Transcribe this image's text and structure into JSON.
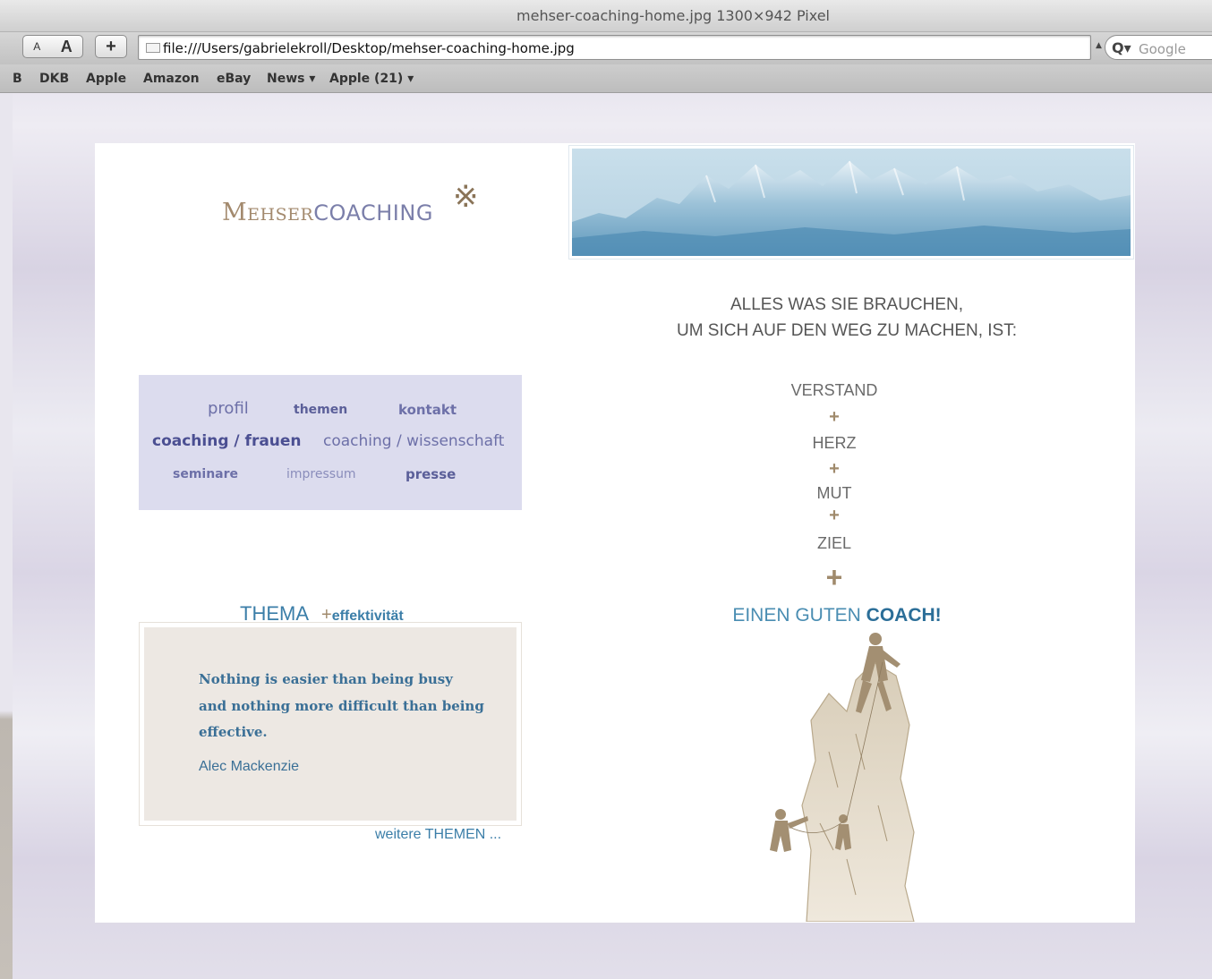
{
  "browser": {
    "window_title": "mehser-coaching-home.jpg 1300×942 Pixel",
    "text_small_label": "A",
    "text_big_label": "A",
    "add_label": "+",
    "address": "file:///Users/gabrielekroll/Desktop/mehser-coaching-home.jpg",
    "search_placeholder": "Google",
    "bookmarks": [
      "B",
      "DKB",
      "Apple",
      "Amazon",
      "eBay",
      "News ▾",
      "Apple (21) ▾"
    ]
  },
  "page": {
    "logo": {
      "part1": "Mehser",
      "part2": "coaching",
      "mark": "※"
    },
    "slogan": [
      "ALLES WAS SIE BRAUCHEN,",
      "UM SICH AUF DEN WEG ZU MACHEN, IST:"
    ],
    "stack": [
      "VERSTAND",
      "HERZ",
      "MUT",
      "ZIEL"
    ],
    "plus": "+",
    "coach_prefix": "EINEN GUTEN ",
    "coach_bold": "COACH!",
    "nav": {
      "profil": "profil",
      "themen": "themen",
      "kontakt": "kontakt",
      "coaching_frauen": "coaching / frauen",
      "coaching_wissenschaft": "coaching / wissenschaft",
      "seminare": "seminare",
      "impressum": "impressum",
      "presse": "presse"
    },
    "thema": {
      "title": "THEMA",
      "plus": "+",
      "subtitle": "effektivität",
      "quote": "Nothing is easier than being busy and nothing more difficult than being effective.",
      "author": "Alec Mackenzie",
      "more_link": "weitere THEMEN ..."
    }
  },
  "colors": {
    "accent_blue": "#3b7ea8",
    "accent_brown": "#a08a6c",
    "nav_background": "#dcdcee",
    "quote_background": "#ede8e3"
  }
}
